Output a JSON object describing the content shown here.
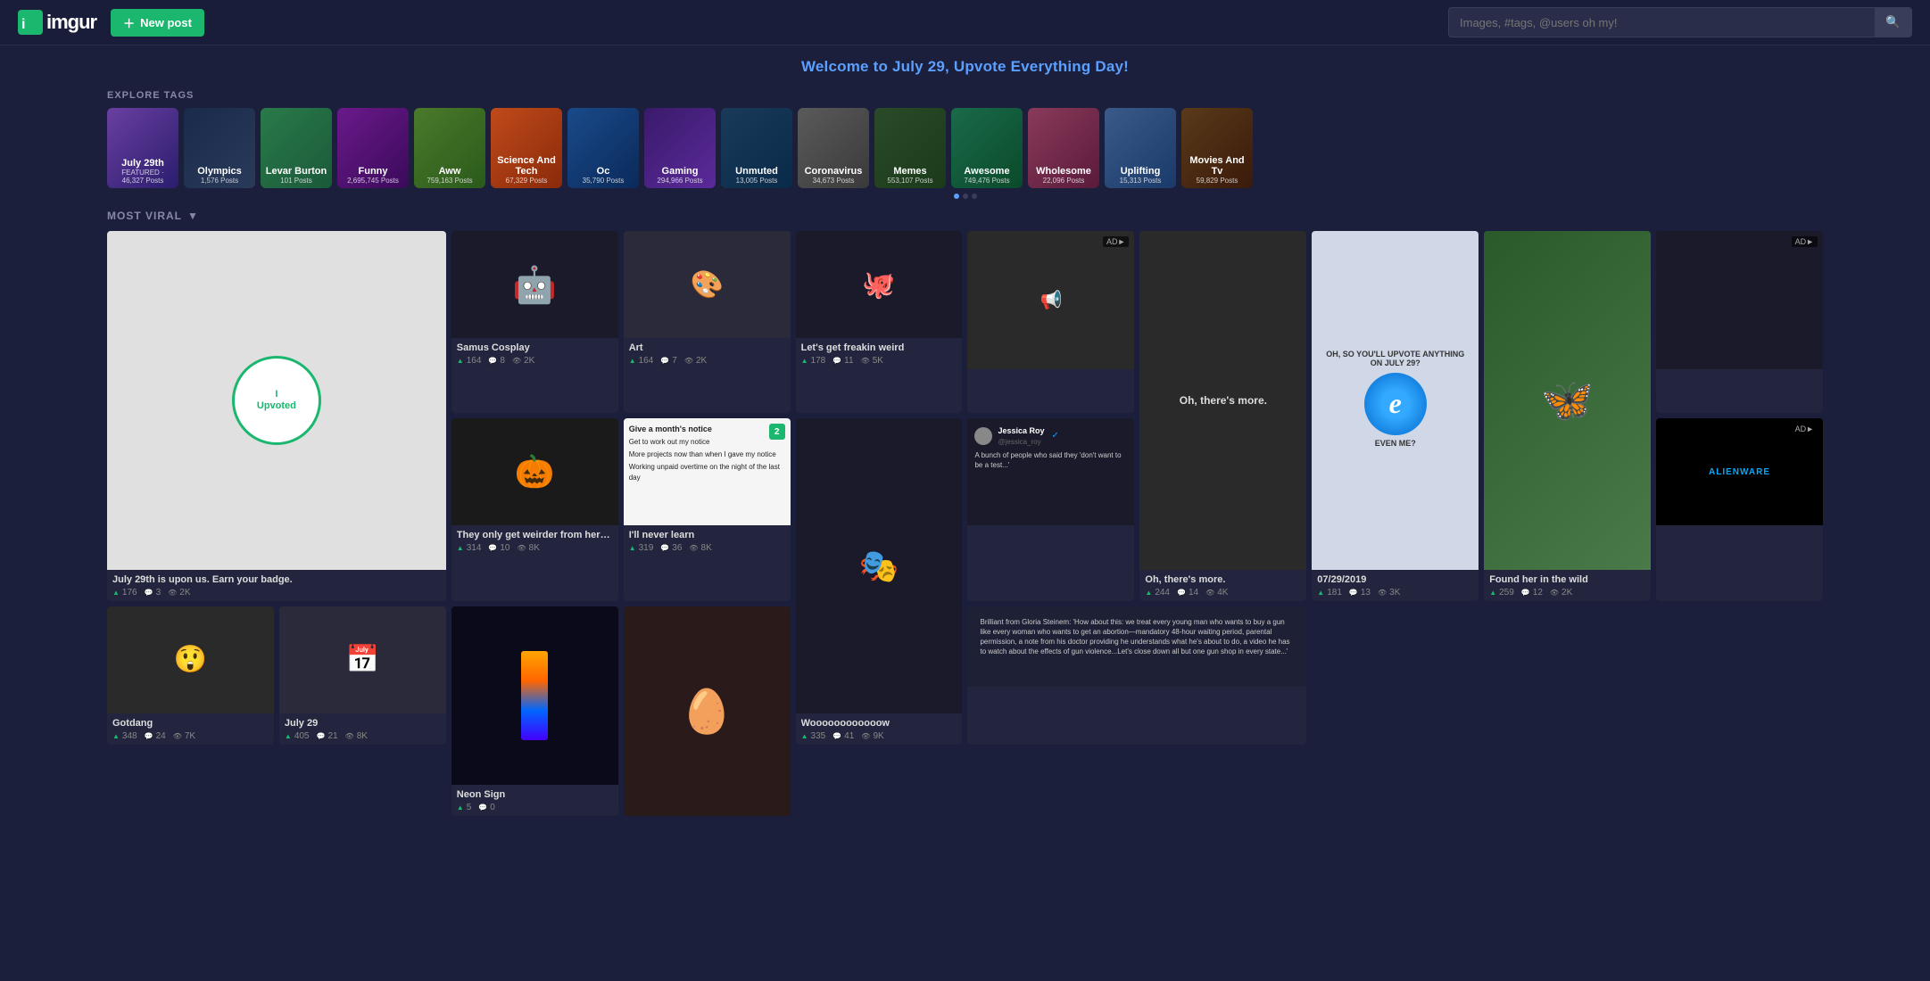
{
  "header": {
    "logo": "imgur",
    "new_post_label": "New post",
    "search_placeholder": "Images, #tags, @users oh my!"
  },
  "welcome_banner": "Welcome to July 29, Upvote Everything Day!",
  "explore": {
    "label": "EXPLORE TAGS",
    "tags": [
      {
        "id": "july",
        "name": "July 29th",
        "sub": "FEATURED · 46,327 Posts",
        "style": "tag-july"
      },
      {
        "id": "olympics",
        "name": "Olympics",
        "sub": "1,576 Posts",
        "style": "tag-olympics"
      },
      {
        "id": "levar",
        "name": "Levar Burton",
        "sub": "101 Posts",
        "style": "tag-levar"
      },
      {
        "id": "funny",
        "name": "Funny",
        "sub": "2,695,745 Posts",
        "style": "tag-funny"
      },
      {
        "id": "aww",
        "name": "Aww",
        "sub": "759,163 Posts",
        "style": "tag-aww"
      },
      {
        "id": "scitech",
        "name": "Science And Tech",
        "sub": "67,329 Posts",
        "style": "tag-scitech"
      },
      {
        "id": "oc",
        "name": "Oc",
        "sub": "35,790 Posts",
        "style": "tag-oc"
      },
      {
        "id": "gaming",
        "name": "Gaming",
        "sub": "294,966 Posts",
        "style": "tag-gaming"
      },
      {
        "id": "unmuted",
        "name": "Unmuted",
        "sub": "13,005 Posts",
        "style": "tag-unmuted"
      },
      {
        "id": "corona",
        "name": "Coronavirus",
        "sub": "34,673 Posts",
        "style": "tag-corona"
      },
      {
        "id": "memes",
        "name": "Memes",
        "sub": "553,107 Posts",
        "style": "tag-memes"
      },
      {
        "id": "awesome",
        "name": "Awesome",
        "sub": "749,476 Posts",
        "style": "tag-awesome"
      },
      {
        "id": "wholesome",
        "name": "Wholesome",
        "sub": "22,096 Posts",
        "style": "tag-wholesome"
      },
      {
        "id": "uplifting",
        "name": "Uplifting",
        "sub": "15,313 Posts",
        "style": "tag-uplifting"
      },
      {
        "id": "movies",
        "name": "Movies And Tv",
        "sub": "59,829 Posts",
        "style": "tag-movies"
      }
    ]
  },
  "viral": {
    "label": "MOST VIRAL",
    "posts": [
      {
        "id": "upvote",
        "title": "July 29th is upon us. Earn your badge.",
        "img_type": "upvote",
        "ups": "176",
        "comments": "3",
        "views": "2K",
        "span": "tall"
      },
      {
        "id": "samus",
        "title": "Samus Cosplay",
        "img_type": "samus",
        "ups": "164",
        "comments": "8",
        "views": "2K"
      },
      {
        "id": "art",
        "title": "Art",
        "img_type": "art",
        "ups": "164",
        "comments": "7",
        "views": "2K"
      },
      {
        "id": "weird",
        "title": "Let's get freakin weird",
        "img_type": "weird",
        "ups": "178",
        "comments": "11",
        "views": "5K"
      },
      {
        "id": "ad1",
        "title": "",
        "img_type": "ad",
        "is_ad": true
      },
      {
        "id": "oh-more",
        "title": "Oh, there's more.",
        "img_type": "oh-more",
        "ups": "244",
        "comments": "14",
        "views": "4K",
        "span": "tall"
      },
      {
        "id": "ie",
        "title": "07/29/2019",
        "img_type": "ie",
        "ups": "181",
        "comments": "13",
        "views": "3K",
        "span": "tall"
      },
      {
        "id": "found",
        "title": "Found her in the wild",
        "img_type": "found",
        "ups": "259",
        "comments": "12",
        "views": "2K",
        "span": "tall"
      },
      {
        "id": "pumpkin",
        "title": "They only get weirder from here...",
        "img_type": "pumpkin",
        "ups": "314",
        "comments": "10",
        "views": "8K"
      },
      {
        "id": "notice",
        "title": "I'll never learn",
        "img_type": "notice",
        "ups": "319",
        "comments": "36",
        "views": "8K",
        "num_badge": "2"
      },
      {
        "id": "wooo",
        "title": "Woooooooooooow",
        "img_type": "wooo",
        "ups": "335",
        "comments": "41",
        "views": "9K",
        "span": "tall"
      },
      {
        "id": "jessica",
        "title": "A bunch of people who said they 'don't want to be a test...'",
        "img_type": "jessica",
        "user": "Jessica Roy",
        "handle": "@jessica_roy",
        "verified": true
      },
      {
        "id": "alienware",
        "title": "",
        "img_type": "alienware",
        "is_ad": true
      },
      {
        "id": "gotdang",
        "title": "Gotdang",
        "img_type": "gotdang",
        "ups": "348",
        "comments": "24",
        "views": "7K"
      },
      {
        "id": "july29",
        "title": "July 29",
        "img_type": "july29",
        "ups": "405",
        "comments": "21",
        "views": "8K"
      },
      {
        "id": "neon",
        "title": "Neon Sign",
        "img_type": "neon",
        "ups": "5",
        "comments": "0",
        "views": "",
        "span": "tall"
      },
      {
        "id": "born",
        "title": "",
        "img_type": "born",
        "span": "tall"
      },
      {
        "id": "gloria",
        "title": "Brilliant from Gloria Steinem...",
        "img_type": "gloria",
        "text": "Brilliant from Gloria Steinem: 'How about this: we treat every young man who wants to buy a gun like every woman who wants to get an abortion—mandatory 48-hour waiting period, parental permission, a note from his doctor providing he understands what he's about to do, a video he has to watch about the effects of gun violence...Let's close down all but one gun shop in every state...'"
      }
    ]
  }
}
